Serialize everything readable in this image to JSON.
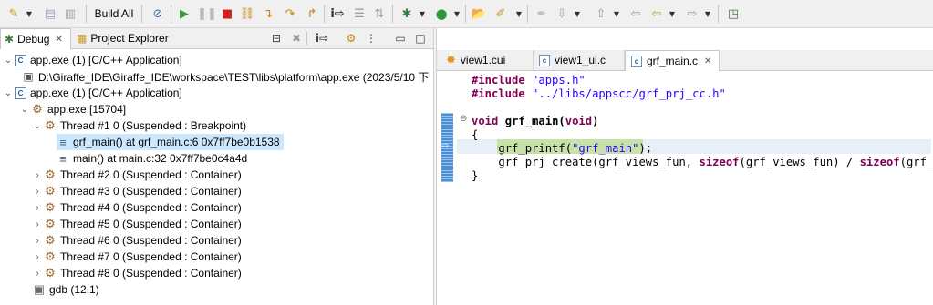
{
  "toolbar": {
    "build_all_label": "Build All"
  },
  "left_panel": {
    "tabs": [
      {
        "label": "Debug",
        "close": "✕"
      },
      {
        "label": "Project Explorer"
      }
    ]
  },
  "debug_tree": [
    {
      "label": "app.exe (1) [C/C++ Application]"
    },
    {
      "label": "D:\\Giraffe_IDE\\Giraffe_IDE\\workspace\\TEST\\libs\\platform\\app.exe (2023/5/10 下"
    },
    {
      "label": "app.exe (1) [C/C++ Application]"
    },
    {
      "label": "app.exe [15704]"
    },
    {
      "label": "Thread #1 0 (Suspended : Breakpoint)"
    },
    {
      "label": "grf_main() at grf_main.c:6 0x7ff7be0b1538"
    },
    {
      "label": "main() at main.c:32 0x7ff7be0c4a4d"
    },
    {
      "label": "Thread #2 0 (Suspended : Container)"
    },
    {
      "label": "Thread #3 0 (Suspended : Container)"
    },
    {
      "label": "Thread #4 0 (Suspended : Container)"
    },
    {
      "label": "Thread #5 0 (Suspended : Container)"
    },
    {
      "label": "Thread #6 0 (Suspended : Container)"
    },
    {
      "label": "Thread #7 0 (Suspended : Container)"
    },
    {
      "label": "Thread #8 0 (Suspended : Container)"
    },
    {
      "label": "gdb (12.1)"
    }
  ],
  "editor": {
    "tabs": [
      {
        "label": "view1.cui"
      },
      {
        "label": "view1_ui.c"
      },
      {
        "label": "grf_main.c",
        "close": "✕"
      }
    ],
    "code": {
      "include1_kw": "#include",
      "include1_str": "\"apps.h\"",
      "include2_kw": "#include",
      "include2_str": "\"../libs/appscc/grf_prj_cc.h\"",
      "func_kw": "void",
      "func_name": "grf_main",
      "func_paren_open": "(",
      "func_param_kw": "void",
      "func_paren_close": ")",
      "open_brace": "{",
      "line_printf_fn": "grf_printf(",
      "line_printf_str": "\"grf_main\"",
      "line_printf_end": ");",
      "line_create_pre": "grf_prj_create(grf_views_fun, ",
      "line_create_kw1": "sizeof",
      "line_create_mid": "(grf_views_fun) / ",
      "line_create_kw2": "sizeof",
      "line_create_end": "(grf_vie",
      "close_brace": "}"
    }
  },
  "colors": {
    "keyword": "#7f0055",
    "string": "#2a00ff",
    "selection": "#cce8ff",
    "current_line_highlight": "#c6e2a8"
  }
}
